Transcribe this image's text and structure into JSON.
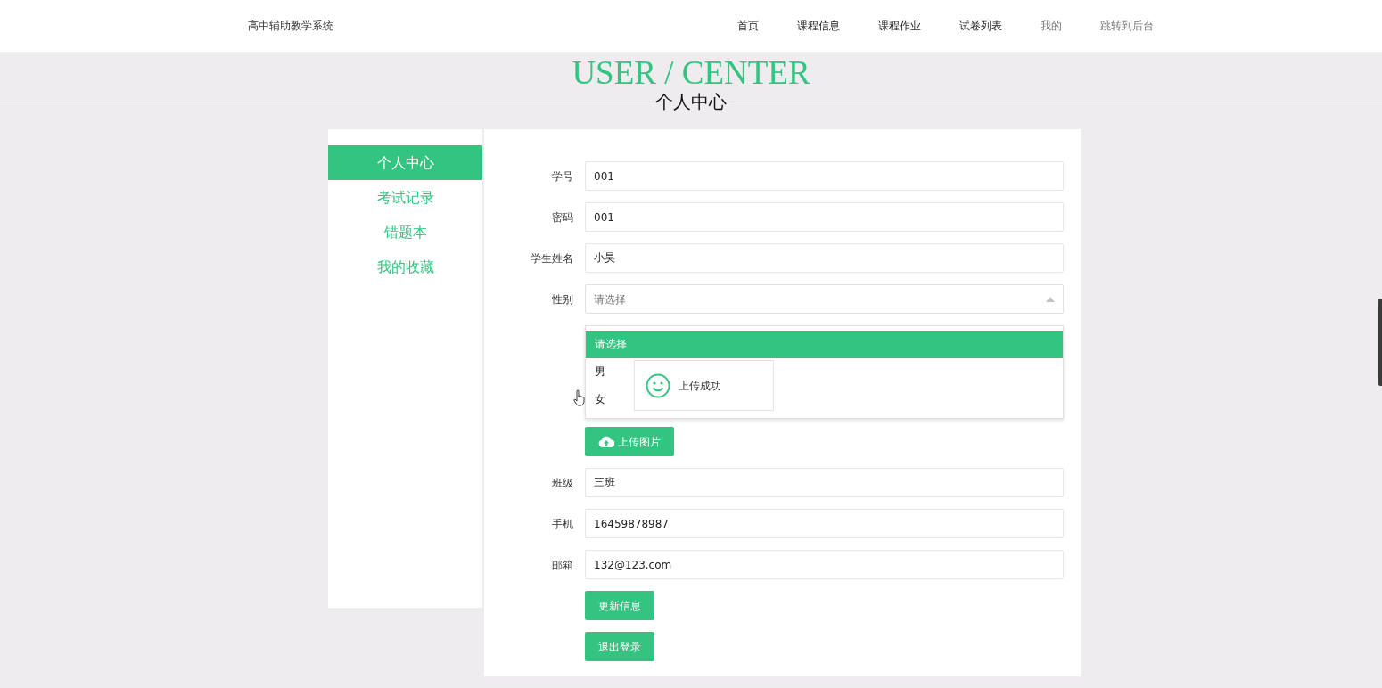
{
  "site_title": "高中辅助教学系统",
  "nav": [
    {
      "label": "首页",
      "muted": false
    },
    {
      "label": "课程信息",
      "muted": false
    },
    {
      "label": "课程作业",
      "muted": false
    },
    {
      "label": "试卷列表",
      "muted": false
    },
    {
      "label": "我的",
      "muted": true
    },
    {
      "label": "跳转到后台",
      "muted": true
    }
  ],
  "banner": {
    "title": "USER / CENTER",
    "subtitle": "个人中心"
  },
  "sidebar": [
    {
      "label": "个人中心",
      "selected": true
    },
    {
      "label": "考试记录",
      "selected": false
    },
    {
      "label": "错题本",
      "selected": false
    },
    {
      "label": "我的收藏",
      "selected": false
    }
  ],
  "form": {
    "fields": [
      {
        "kind": "text",
        "label": "学号",
        "value": "001"
      },
      {
        "kind": "text",
        "label": "密码",
        "value": "001"
      },
      {
        "kind": "text",
        "label": "学生姓名",
        "value": "小昊"
      },
      {
        "kind": "select",
        "label": "性别",
        "placeholder": "请选择",
        "expanded": true,
        "options": [
          {
            "label": "请选择",
            "selected": true
          },
          {
            "label": "男",
            "selected": false
          },
          {
            "label": "女",
            "selected": false
          }
        ]
      },
      {
        "kind": "upload",
        "button": "上传图片"
      },
      {
        "kind": "text",
        "label": "班级",
        "value": "三班"
      },
      {
        "kind": "text",
        "label": "手机",
        "value": "16459878987"
      },
      {
        "kind": "text",
        "label": "邮箱",
        "value": "132@123.com"
      }
    ],
    "buttons": [
      "更新信息",
      "退出登录"
    ]
  },
  "toast": {
    "message": "上传成功"
  }
}
